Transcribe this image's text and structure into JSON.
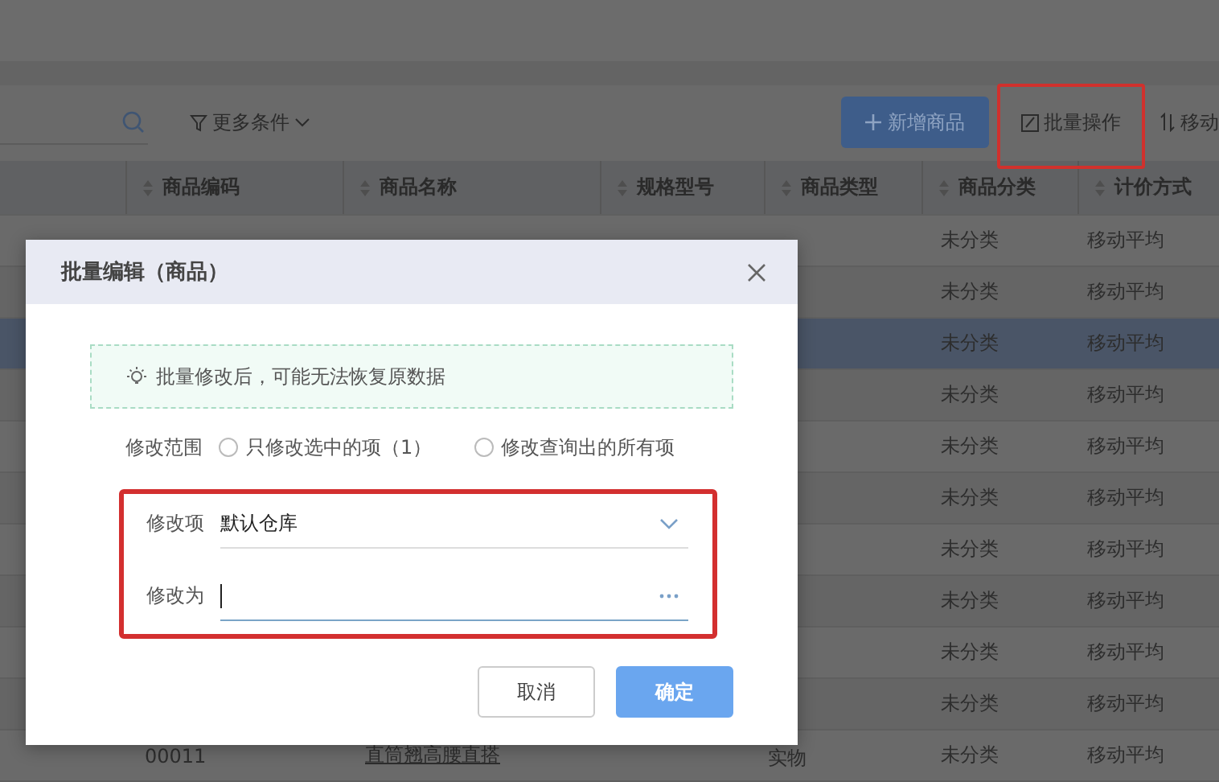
{
  "toolbar": {
    "filter_label": "更多条件",
    "add_button": "新增商品",
    "batch_button": "批量操作",
    "move_button": "移动"
  },
  "table": {
    "columns": [
      "商品编码",
      "商品名称",
      "规格型号",
      "商品类型",
      "商品分类",
      "计价方式"
    ],
    "rows": [
      {
        "selected": false,
        "category": "未分类",
        "pricing": "移动平均"
      },
      {
        "selected": false,
        "category": "未分类",
        "pricing": "移动平均"
      },
      {
        "selected": true,
        "category": "未分类",
        "pricing": "移动平均"
      },
      {
        "selected": false,
        "category": "未分类",
        "pricing": "移动平均"
      },
      {
        "selected": false,
        "category": "未分类",
        "pricing": "移动平均"
      },
      {
        "selected": false,
        "category": "未分类",
        "pricing": "移动平均"
      },
      {
        "selected": false,
        "category": "未分类",
        "pricing": "移动平均"
      },
      {
        "selected": false,
        "category": "未分类",
        "pricing": "移动平均"
      },
      {
        "selected": false,
        "category": "未分类",
        "pricing": "移动平均"
      },
      {
        "selected": false,
        "category": "未分类",
        "pricing": "移动平均"
      },
      {
        "selected": false,
        "code": "00011",
        "name": "直筒翘高腰直搭",
        "type": "实物",
        "category": "未分类",
        "pricing": "移动平均"
      }
    ]
  },
  "dialog": {
    "title": "批量编辑（商品）",
    "notice": "批量修改后，可能无法恢复原数据",
    "scope_label": "修改范围",
    "scope_options": [
      {
        "label": "只修改选中的项（1）",
        "selected": false
      },
      {
        "label": "修改查询出的所有项",
        "selected": false
      }
    ],
    "fields": [
      {
        "kind": "select",
        "label": "修改项",
        "value": "默认仓库",
        "focused": false
      },
      {
        "kind": "picker",
        "label": "修改为",
        "focused": true
      }
    ],
    "buttons": [
      {
        "kind": "secondary",
        "label": "取消"
      },
      {
        "kind": "primary",
        "label": "确定"
      }
    ]
  }
}
